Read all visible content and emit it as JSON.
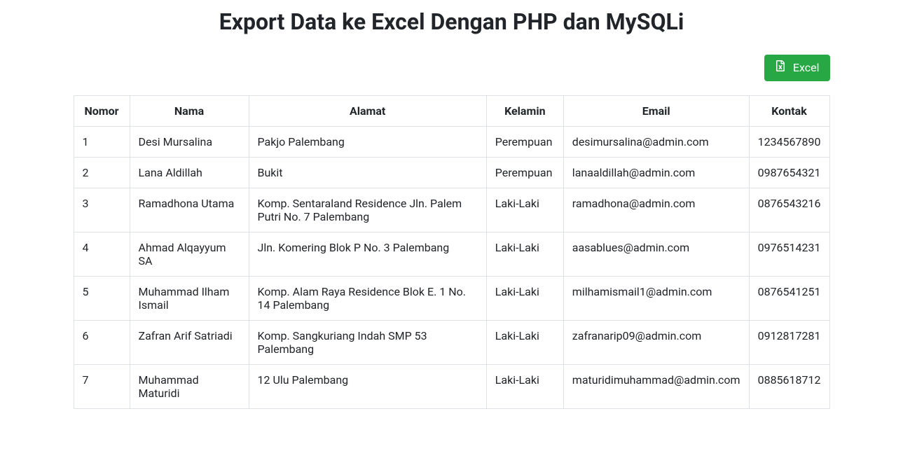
{
  "page": {
    "title": "Export Data ke Excel Dengan PHP dan MySQLi"
  },
  "toolbar": {
    "excel_label": "Excel"
  },
  "table": {
    "headers": {
      "nomor": "Nomor",
      "nama": "Nama",
      "alamat": "Alamat",
      "kelamin": "Kelamin",
      "email": "Email",
      "kontak": "Kontak"
    },
    "rows": [
      {
        "nomor": "1",
        "nama": "Desi Mursalina",
        "alamat": "Pakjo Palembang",
        "kelamin": "Perempuan",
        "email": "desimursalina@admin.com",
        "kontak": "1234567890"
      },
      {
        "nomor": "2",
        "nama": "Lana Aldillah",
        "alamat": "Bukit",
        "kelamin": "Perempuan",
        "email": "lanaaldillah@admin.com",
        "kontak": "0987654321"
      },
      {
        "nomor": "3",
        "nama": "Ramadhona Utama",
        "alamat": "Komp. Sentaraland Residence Jln. Palem Putri No. 7 Palembang",
        "kelamin": "Laki-Laki",
        "email": "ramadhona@admin.com",
        "kontak": "0876543216"
      },
      {
        "nomor": "4",
        "nama": "Ahmad Alqayyum SA",
        "alamat": "Jln. Komering Blok P No. 3 Palembang",
        "kelamin": "Laki-Laki",
        "email": "aasablues@admin.com",
        "kontak": "0976514231"
      },
      {
        "nomor": "5",
        "nama": "Muhammad Ilham Ismail",
        "alamat": "Komp. Alam Raya Residence Blok E. 1 No. 14 Palembang",
        "kelamin": "Laki-Laki",
        "email": "milhamismail1@admin.com",
        "kontak": "0876541251"
      },
      {
        "nomor": "6",
        "nama": "Zafran Arif Satriadi",
        "alamat": "Komp. Sangkuriang Indah SMP 53 Palembang",
        "kelamin": "Laki-Laki",
        "email": "zafranarip09@admin.com",
        "kontak": "0912817281"
      },
      {
        "nomor": "7",
        "nama": "Muhammad Maturidi",
        "alamat": "12 Ulu Palembang",
        "kelamin": "Laki-Laki",
        "email": "maturidimuhammad@admin.com",
        "kontak": "0885618712"
      }
    ]
  }
}
